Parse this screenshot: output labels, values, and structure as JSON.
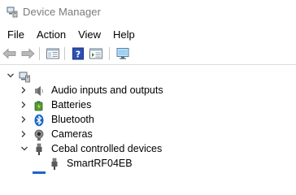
{
  "window": {
    "title": "Device Manager",
    "icon": "device-manager-icon"
  },
  "menu": {
    "items": [
      {
        "label": "File"
      },
      {
        "label": "Action"
      },
      {
        "label": "View"
      },
      {
        "label": "Help"
      }
    ]
  },
  "toolbar": {
    "buttons": [
      {
        "icon": "back-arrow-icon"
      },
      {
        "icon": "forward-arrow-icon"
      },
      {
        "icon": "show-hide-console-tree-icon"
      },
      {
        "icon": "help-icon"
      },
      {
        "icon": "properties-pane-icon"
      },
      {
        "icon": "scan-hardware-monitor-icon"
      }
    ]
  },
  "tree": {
    "root": {
      "label": "",
      "icon": "computer-icon",
      "expanded": true
    },
    "nodes": [
      {
        "label": "Audio inputs and outputs",
        "icon": "speaker-icon",
        "expanded": false
      },
      {
        "label": "Batteries",
        "icon": "battery-icon",
        "expanded": false
      },
      {
        "label": "Bluetooth",
        "icon": "bluetooth-icon",
        "expanded": false
      },
      {
        "label": "Cameras",
        "icon": "camera-icon",
        "expanded": false
      },
      {
        "label": "Cebal controlled devices",
        "icon": "usb-plug-icon",
        "expanded": true,
        "children": [
          {
            "label": "SmartRF04EB",
            "icon": "usb-plug-icon"
          }
        ]
      }
    ]
  },
  "colors": {
    "title_text": "#7a7a7a",
    "bluetooth_blue": "#1a66c9",
    "toolbar_border": "#dcdcdc"
  }
}
